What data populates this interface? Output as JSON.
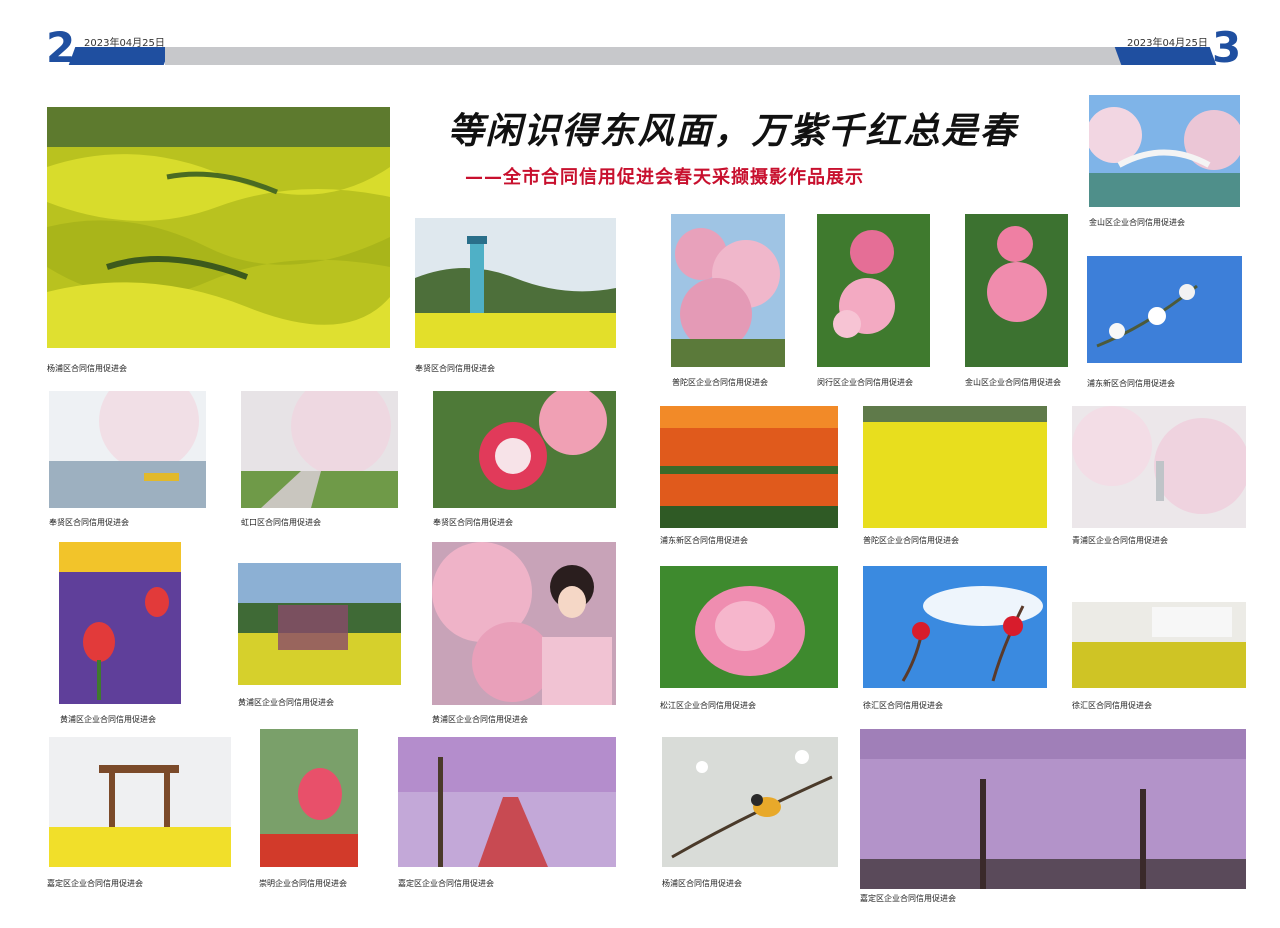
{
  "header": {
    "page_left": "2",
    "page_right": "3",
    "date_left": "2023年04月25日",
    "date_right": "2023年04月25日",
    "accent_color": "#1f4fa0"
  },
  "title": "等闲识得东风面，万紫千红总是春",
  "subtitle": "——全市合同信用促进会春天采撷摄影作品展示",
  "captions": {
    "c1": "杨浦区合同信用促进会",
    "c2": "奉贤区合同信用促进会",
    "c3": "普陀区企业合同信用促进会",
    "c4": "闵行区企业合同信用促进会",
    "c5": "金山区企业合同信用促进会",
    "c6": "金山区企业合同信用促进会",
    "c7": "浦东新区合同信用促进会",
    "c8": "奉贤区合同信用促进会",
    "c9": "虹口区合同信用促进会",
    "c10": "奉贤区合同信用促进会",
    "c11": "浦东新区合同信用促进会",
    "c12": "普陀区企业合同信用促进会",
    "c13": "青浦区企业合同信用促进会",
    "c14": "黄浦区企业合同信用促进会",
    "c15": "黄浦区企业合同信用促进会",
    "c16": "黄浦区企业合同信用促进会",
    "c17": "松江区企业合同信用促进会",
    "c18": "徐汇区合同信用促进会",
    "c19": "徐汇区合同信用促进会",
    "c20": "嘉定区企业合同信用促进会",
    "c21": "崇明企业合同信用促进会",
    "c22": "嘉定区企业合同信用促进会",
    "c23": "杨浦区合同信用促进会",
    "c24": "嘉定区企业合同信用促进会"
  }
}
